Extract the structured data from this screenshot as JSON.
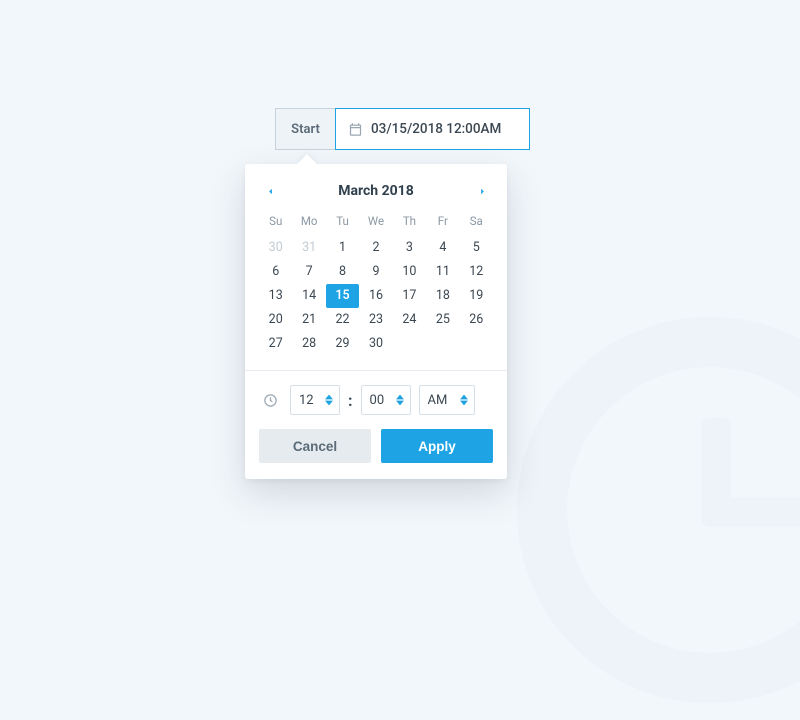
{
  "input": {
    "start_label": "Start",
    "value": "03/15/2018  12:00AM"
  },
  "calendar": {
    "month_title": "March 2018",
    "dow": [
      "Su",
      "Mo",
      "Tu",
      "We",
      "Th",
      "Fr",
      "Sa"
    ],
    "weeks": [
      [
        {
          "n": "30",
          "muted": true
        },
        {
          "n": "31",
          "muted": true
        },
        {
          "n": "1"
        },
        {
          "n": "2"
        },
        {
          "n": "3"
        },
        {
          "n": "4"
        },
        {
          "n": "5"
        }
      ],
      [
        {
          "n": "6"
        },
        {
          "n": "7"
        },
        {
          "n": "8"
        },
        {
          "n": "9"
        },
        {
          "n": "10"
        },
        {
          "n": "11"
        },
        {
          "n": "12"
        }
      ],
      [
        {
          "n": "13"
        },
        {
          "n": "14"
        },
        {
          "n": "15",
          "selected": true
        },
        {
          "n": "16"
        },
        {
          "n": "17"
        },
        {
          "n": "18"
        },
        {
          "n": "19"
        }
      ],
      [
        {
          "n": "20"
        },
        {
          "n": "21"
        },
        {
          "n": "22"
        },
        {
          "n": "23"
        },
        {
          "n": "24"
        },
        {
          "n": "25"
        },
        {
          "n": "26"
        }
      ],
      [
        {
          "n": "27"
        },
        {
          "n": "28"
        },
        {
          "n": "29"
        },
        {
          "n": "30"
        },
        {
          "n": ""
        },
        {
          "n": ""
        },
        {
          "n": ""
        }
      ]
    ]
  },
  "time": {
    "hour": "12",
    "minute": "00",
    "ampm": "AM"
  },
  "actions": {
    "cancel": "Cancel",
    "apply": "Apply"
  }
}
